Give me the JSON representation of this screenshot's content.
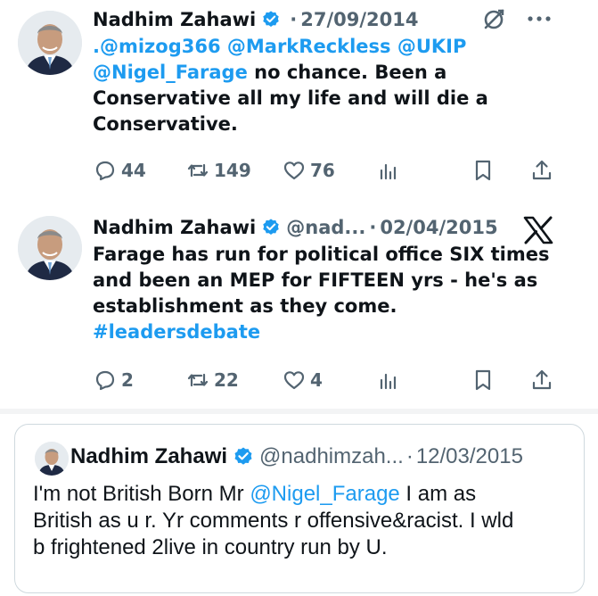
{
  "tweets": [
    {
      "name": "Nadhim Zahawi",
      "dot": "·",
      "date": "27/09/2014",
      "body_mentions_1": ".@mizog366 @MarkReckless @UKIP",
      "body_mentions_2": "@Nigel_Farage",
      "body_text_1": " no chance. Been a",
      "body_text_2": "Conservative all my life and will die a",
      "body_text_3": "Conservative.",
      "replies": "44",
      "reposts": "149",
      "likes": "76"
    },
    {
      "name": "Nadhim Zahawi",
      "handle": "@nad...",
      "dot": "·",
      "date": "02/04/2015",
      "body_text_1": "Farage has run for political office SIX times",
      "body_text_2": "and been an MEP for FIFTEEN yrs - he's as",
      "body_text_3": "establishment as they come.",
      "hashtag": "#leadersdebate",
      "replies": "2",
      "reposts": "22",
      "likes": "4"
    }
  ],
  "quote": {
    "name": "Nadhim Zahawi",
    "handle": "@nadhimzah...",
    "dot": "·",
    "date": "12/03/2015",
    "body_text_1": "I'm not British Born Mr ",
    "body_mention": "@Nigel_Farage",
    "body_text_2": " I am as",
    "body_text_3": "British as u r. Yr comments r offensive&racist. I wld",
    "body_text_4": "b frightened 2live in country run by U."
  },
  "colors": {
    "text": "#0f1419",
    "secondary": "#536471",
    "accent": "#1d9bf0",
    "divider": "#eff3f4"
  },
  "icons": [
    "verified-badge-icon",
    "grok-icon",
    "more-icon",
    "x-logo-icon",
    "reply-icon",
    "repost-icon",
    "like-icon",
    "views-icon",
    "bookmark-icon",
    "share-icon"
  ]
}
